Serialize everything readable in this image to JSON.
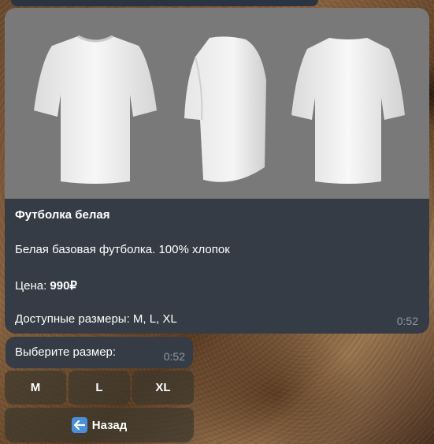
{
  "product": {
    "title": "Футболка белая",
    "description": "Белая базовая футболка. 100% хлопок",
    "price_label": "Цена: ",
    "price_value": "990₽",
    "sizes_text": "Доступные размеры: M, L, XL",
    "time": "0:52"
  },
  "prompt": {
    "text": "Выберите размер:",
    "time": "0:52"
  },
  "keyboard": {
    "size_m": "M",
    "size_l": "L",
    "size_xl": "XL",
    "back": "Назад"
  },
  "icons": {
    "back": "back-arrow-icon"
  },
  "colors": {
    "bubble": "#353c45",
    "photo_bg": "#797979",
    "timestamp": "#8f98a3"
  }
}
